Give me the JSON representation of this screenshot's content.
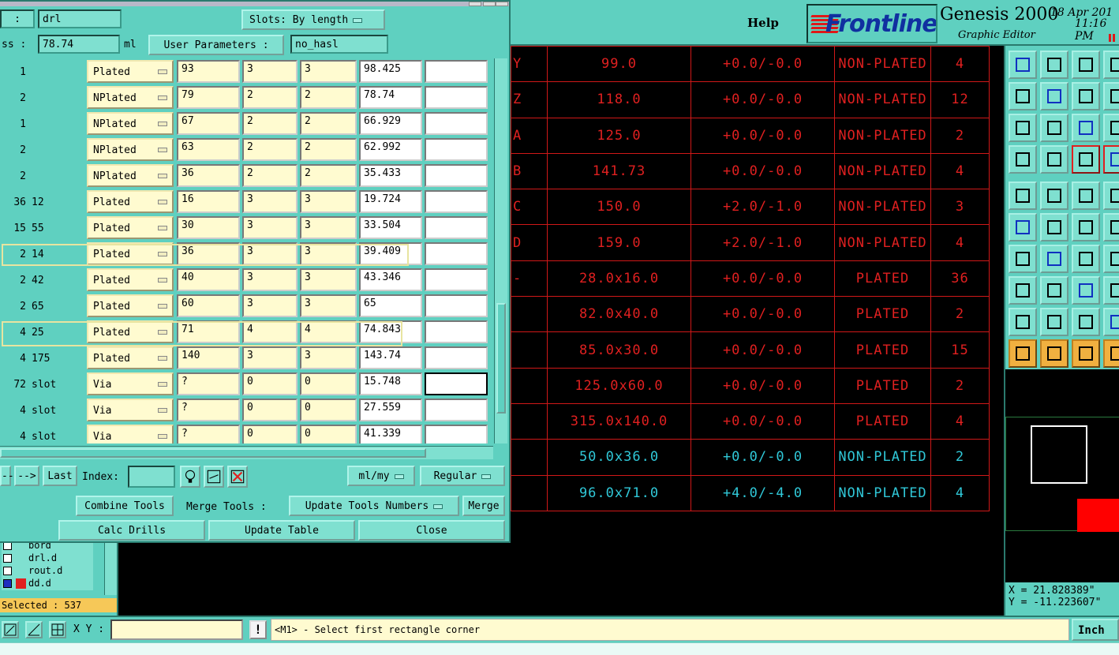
{
  "header": {
    "help": "Help",
    "brand": "Frontline",
    "app_name": "Genesis 2000",
    "app_subtitle": "Graphic Editor",
    "date": "18 Apr 201",
    "time": "11:16 PM"
  },
  "dialog": {
    "layer_label": ":",
    "layer_value": "drl",
    "slots_label": "Slots:",
    "slots_value": "By length",
    "thickness_label": "ss :",
    "thickness_value": "78.74",
    "thickness_unit": "ml",
    "user_params_label": "User Parameters :",
    "user_params_value": "no_hasl",
    "rows": [
      {
        "count": "1",
        "size": "",
        "type": "Plated",
        "a": "93",
        "b": "3",
        "c": "3",
        "d": "98.425",
        "e": ""
      },
      {
        "count": "2",
        "size": "",
        "type": "NPlated",
        "a": "79",
        "b": "2",
        "c": "2",
        "d": "78.74",
        "e": ""
      },
      {
        "count": "1",
        "size": "",
        "type": "NPlated",
        "a": "67",
        "b": "2",
        "c": "2",
        "d": "66.929",
        "e": ""
      },
      {
        "count": "2",
        "size": "",
        "type": "NPlated",
        "a": "63",
        "b": "2",
        "c": "2",
        "d": "62.992",
        "e": ""
      },
      {
        "count": "2",
        "size": "",
        "type": "NPlated",
        "a": "36",
        "b": "2",
        "c": "2",
        "d": "35.433",
        "e": ""
      },
      {
        "count": "36",
        "size": "12",
        "type": "Plated",
        "a": "16",
        "b": "3",
        "c": "3",
        "d": "19.724",
        "e": ""
      },
      {
        "count": "15",
        "size": "55",
        "type": "Plated",
        "a": "30",
        "b": "3",
        "c": "3",
        "d": "33.504",
        "e": ""
      },
      {
        "count": "2",
        "size": "14",
        "type": "Plated",
        "a": "36",
        "b": "3",
        "c": "3",
        "d": "39.409",
        "e": ""
      },
      {
        "count": "2",
        "size": "42",
        "type": "Plated",
        "a": "40",
        "b": "3",
        "c": "3",
        "d": "43.346",
        "e": ""
      },
      {
        "count": "2",
        "size": "65",
        "type": "Plated",
        "a": "60",
        "b": "3",
        "c": "3",
        "d": "65",
        "e": ""
      },
      {
        "count": "4",
        "size": "25",
        "type": "Plated",
        "a": "71",
        "b": "4",
        "c": "4",
        "d": "74.843",
        "e": ""
      },
      {
        "count": "4",
        "size": "175",
        "type": "Plated",
        "a": "140",
        "b": "3",
        "c": "3",
        "d": "143.74",
        "e": ""
      },
      {
        "count": "72",
        "size": "slot",
        "type": "Via",
        "a": "?",
        "b": "0",
        "c": "0",
        "d": "15.748",
        "e": ""
      },
      {
        "count": "4",
        "size": "slot",
        "type": "Via",
        "a": "?",
        "b": "0",
        "c": "0",
        "d": "27.559",
        "e": ""
      },
      {
        "count": "4",
        "size": "slot",
        "type": "Via",
        "a": "?",
        "b": "0",
        "c": "0",
        "d": "41.339",
        "e": ""
      }
    ],
    "nav_prev": "--",
    "nav_next": "-->",
    "nav_last": "Last",
    "index_label": "Index:",
    "units_value": "ml/my",
    "mode_value": "Regular",
    "combine_tools": "Combine Tools",
    "merge_tools_label": "Merge Tools :",
    "merge_mode_value": "Update Tools Numbers",
    "merge_button": "Merge",
    "calc_drills": "Calc Drills",
    "update_table": "Update Table",
    "close": "Close"
  },
  "drill_table": [
    {
      "id": "Y",
      "size": "99.0",
      "tol": "+0.0/-0.0",
      "plating": "NON-PLATED",
      "count": "4",
      "color": "red"
    },
    {
      "id": "Z",
      "size": "118.0",
      "tol": "+0.0/-0.0",
      "plating": "NON-PLATED",
      "count": "12",
      "color": "red"
    },
    {
      "id": "A",
      "size": "125.0",
      "tol": "+0.0/-0.0",
      "plating": "NON-PLATED",
      "count": "2",
      "color": "red"
    },
    {
      "id": "B",
      "size": "141.73",
      "tol": "+0.0/-0.0",
      "plating": "NON-PLATED",
      "count": "4",
      "color": "red"
    },
    {
      "id": "C",
      "size": "150.0",
      "tol": "+2.0/-1.0",
      "plating": "NON-PLATED",
      "count": "3",
      "color": "red"
    },
    {
      "id": "D",
      "size": "159.0",
      "tol": "+2.0/-1.0",
      "plating": "NON-PLATED",
      "count": "4",
      "color": "red"
    },
    {
      "id": "-",
      "size": "28.0x16.0",
      "tol": "+0.0/-0.0",
      "plating": "PLATED",
      "count": "36",
      "color": "red"
    },
    {
      "id": "",
      "size": "82.0x40.0",
      "tol": "+0.0/-0.0",
      "plating": "PLATED",
      "count": "2",
      "color": "red"
    },
    {
      "id": "",
      "size": "85.0x30.0",
      "tol": "+0.0/-0.0",
      "plating": "PLATED",
      "count": "15",
      "color": "red"
    },
    {
      "id": "",
      "size": "125.0x60.0",
      "tol": "+0.0/-0.0",
      "plating": "PLATED",
      "count": "2",
      "color": "red"
    },
    {
      "id": "",
      "size": "315.0x140.0",
      "tol": "+0.0/-0.0",
      "plating": "PLATED",
      "count": "4",
      "color": "red"
    },
    {
      "id": "",
      "size": "50.0x36.0",
      "tol": "+0.0/-0.0",
      "plating": "NON-PLATED",
      "count": "2",
      "color": "cyan"
    },
    {
      "id": "",
      "size": "96.0x71.0",
      "tol": "+4.0/-4.0",
      "plating": "NON-PLATED",
      "count": "4",
      "color": "cyan"
    }
  ],
  "layers": [
    {
      "name": "bord"
    },
    {
      "name": "drl.d"
    },
    {
      "name": "rout.d"
    },
    {
      "name": "dd.d"
    }
  ],
  "selected": "Selected : 537",
  "coords": {
    "x": "X = 21.828389\"",
    "y": "Y = -11.223607\""
  },
  "status": {
    "xy_label": "X Y :",
    "xy_value": "",
    "bang": "!",
    "prompt": "<M1> - Select first rectangle corner",
    "units": "Inch"
  },
  "colors": {
    "panel": "#5fd0c0",
    "field": "#fffbd0",
    "drill_red": "#e02020",
    "drill_cyan": "#30c8d8"
  }
}
